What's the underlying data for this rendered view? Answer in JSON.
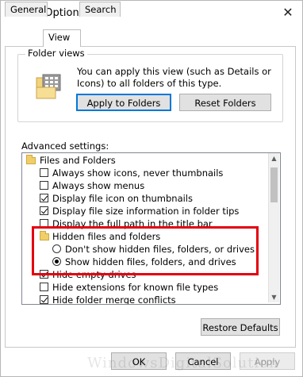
{
  "window": {
    "title": "Folder Options",
    "close_glyph": "✕"
  },
  "tabs": [
    {
      "label": "General"
    },
    {
      "label": "View"
    },
    {
      "label": "Search"
    }
  ],
  "folder_views": {
    "group_label": "Folder views",
    "description": "You can apply this view (such as Details or Icons) to all folders of this type.",
    "apply_button": "Apply to Folders",
    "reset_button": "Reset Folders"
  },
  "advanced": {
    "label": "Advanced settings:",
    "items": [
      {
        "type": "folder",
        "label": "Files and Folders"
      },
      {
        "type": "checkbox",
        "checked": false,
        "label": "Always show icons, never thumbnails"
      },
      {
        "type": "checkbox",
        "checked": false,
        "label": "Always show menus"
      },
      {
        "type": "checkbox",
        "checked": true,
        "label": "Display file icon on thumbnails"
      },
      {
        "type": "checkbox",
        "checked": true,
        "label": "Display file size information in folder tips"
      },
      {
        "type": "checkbox",
        "checked": false,
        "label": "Display the full path in the title bar"
      },
      {
        "type": "folder",
        "label": "Hidden files and folders"
      },
      {
        "type": "radio",
        "checked": false,
        "label": "Don't show hidden files, folders, or drives"
      },
      {
        "type": "radio",
        "checked": true,
        "label": "Show hidden files, folders, and drives"
      },
      {
        "type": "checkbox",
        "checked": true,
        "label": "Hide empty drives"
      },
      {
        "type": "checkbox",
        "checked": false,
        "label": "Hide extensions for known file types"
      },
      {
        "type": "checkbox",
        "checked": true,
        "label": "Hide folder merge conflicts"
      }
    ]
  },
  "buttons": {
    "restore": "Restore Defaults",
    "ok": "OK",
    "cancel": "Cancel",
    "apply": "Apply"
  },
  "watermark": "WindowsDigitalSolution",
  "colors": {
    "highlight": "#e3000f",
    "accent": "#0078d7"
  }
}
